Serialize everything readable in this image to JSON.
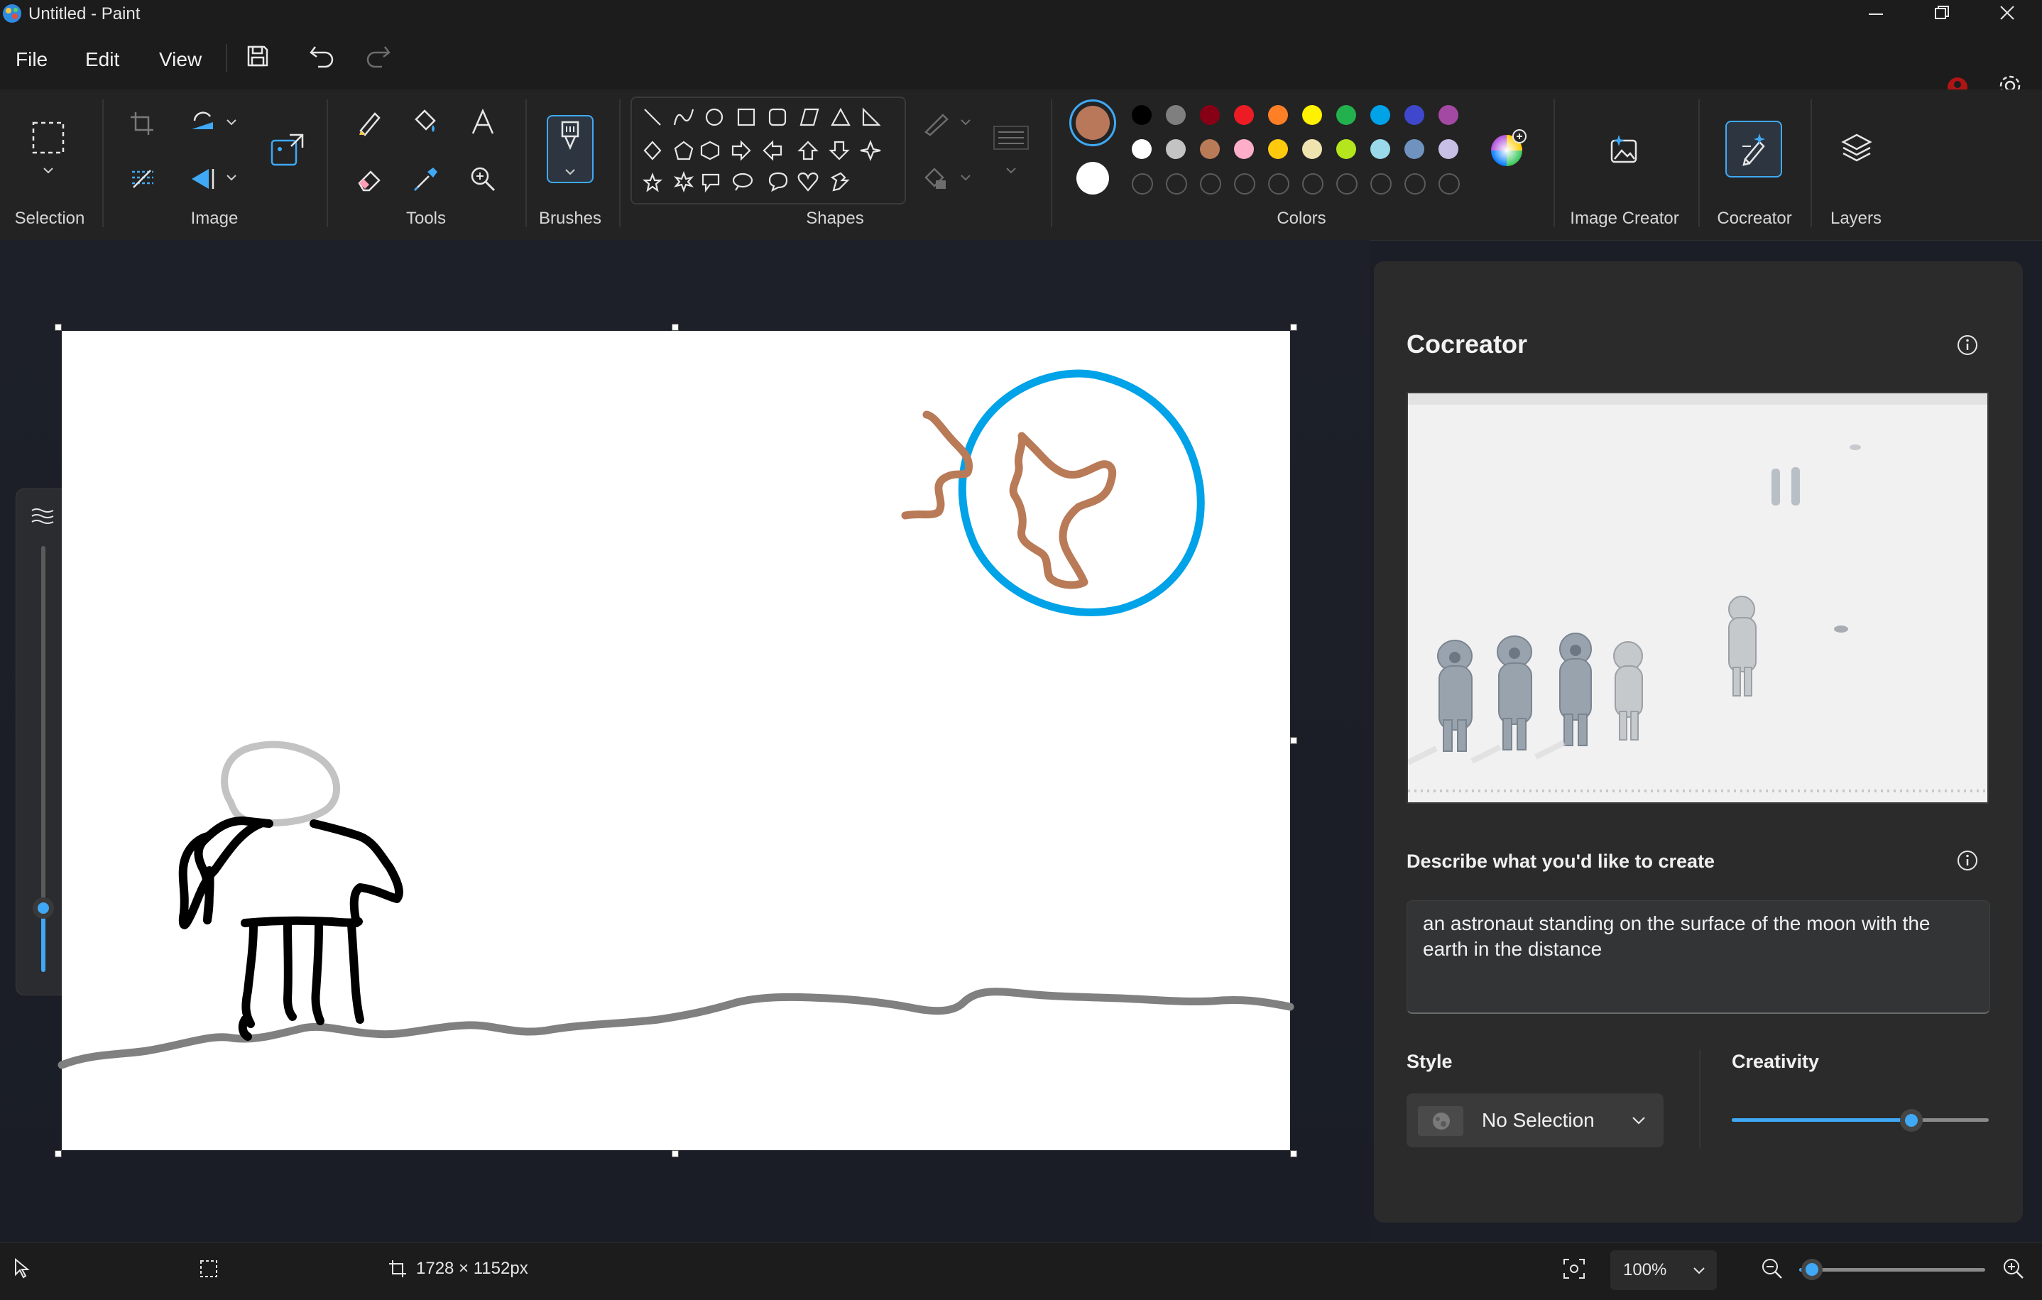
{
  "window": {
    "title": "Untitled - Paint"
  },
  "menu": {
    "file": "File",
    "edit": "Edit",
    "view": "View"
  },
  "ribbon": {
    "groups": {
      "selection": "Selection",
      "image": "Image",
      "tools": "Tools",
      "brushes": "Brushes",
      "shapes": "Shapes",
      "colors": "Colors",
      "image_creator": "Image Creator",
      "cocreator": "Cocreator",
      "layers": "Layers"
    },
    "colors": {
      "primary": "#b9785a",
      "secondary": "#ffffff",
      "row1": [
        "#000000",
        "#7f7f7f",
        "#880015",
        "#ed1c24",
        "#ff7f27",
        "#fff200",
        "#22b14c",
        "#00a2e8",
        "#3f48cc",
        "#a349a4"
      ],
      "row2": [
        "#ffffff",
        "#c3c3c3",
        "#b97a57",
        "#ffaec9",
        "#ffc90e",
        "#efe4b0",
        "#b5e61d",
        "#99d9ea",
        "#7092be",
        "#c8bfe7"
      ]
    }
  },
  "cocreator": {
    "title": "Cocreator",
    "prompt_label": "Describe what you'd like to create",
    "prompt_text": "an astronaut standing on the surface of the moon with the earth in the distance",
    "style_label": "Style",
    "style_value": "No Selection",
    "creativity_label": "Creativity",
    "creativity_value": 0.7
  },
  "status": {
    "canvas_size": "1728 × 1152px",
    "zoom": "100%",
    "zoom_slider": 0.07
  },
  "brush_size_level": 0.15,
  "accent": "#3fa9f5"
}
